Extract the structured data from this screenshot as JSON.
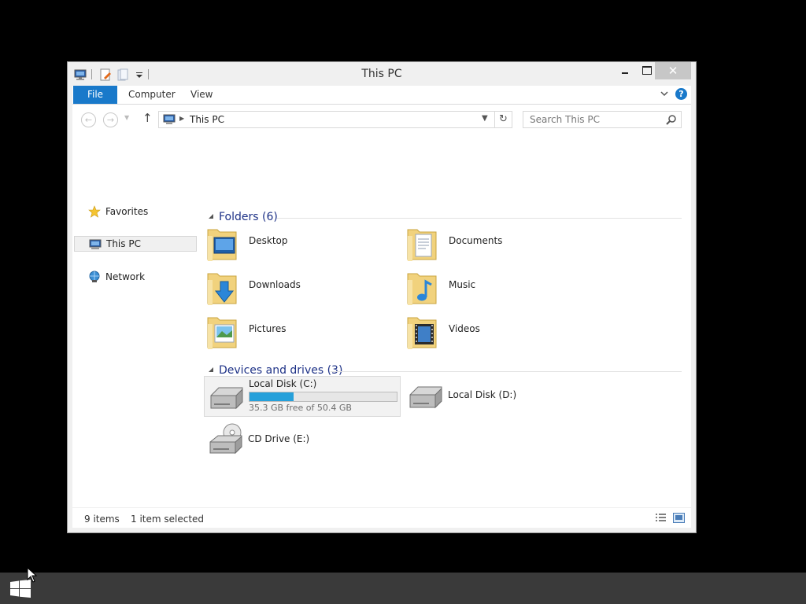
{
  "window": {
    "title": "This PC",
    "controls": {
      "close_glyph": "✕"
    }
  },
  "ribbon": {
    "tabs": [
      "File",
      "Computer",
      "View"
    ],
    "help_glyph": "?"
  },
  "navigation": {
    "address_path": "This PC",
    "search_placeholder": "Search This PC"
  },
  "nav_pane": {
    "items": [
      {
        "label": "Favorites",
        "icon": "star-icon"
      },
      {
        "label": "This PC",
        "icon": "computer-icon",
        "selected": true
      },
      {
        "label": "Network",
        "icon": "network-icon"
      }
    ]
  },
  "groups": {
    "folders": {
      "title": "Folders (6)",
      "items": [
        {
          "label": "Desktop",
          "icon": "desktop-folder-icon"
        },
        {
          "label": "Documents",
          "icon": "documents-folder-icon"
        },
        {
          "label": "Downloads",
          "icon": "downloads-folder-icon"
        },
        {
          "label": "Music",
          "icon": "music-folder-icon"
        },
        {
          "label": "Pictures",
          "icon": "pictures-folder-icon"
        },
        {
          "label": "Videos",
          "icon": "videos-folder-icon"
        }
      ]
    },
    "devices": {
      "title": "Devices and drives (3)",
      "items": [
        {
          "label": "Local Disk (C:)",
          "free_text": "35.3 GB free of 50.4 GB",
          "used_fraction": 0.3,
          "selected": true,
          "icon": "hard-disk-icon"
        },
        {
          "label": "Local Disk (D:)",
          "icon": "hard-disk-icon"
        },
        {
          "label": "CD Drive (E:)",
          "icon": "cd-drive-icon"
        }
      ]
    }
  },
  "status_bar": {
    "item_count": "9 items",
    "selection": "1 item selected"
  },
  "colors": {
    "accent": "#1979ca",
    "progress": "#26a0da",
    "group_title": "#1e3287"
  }
}
